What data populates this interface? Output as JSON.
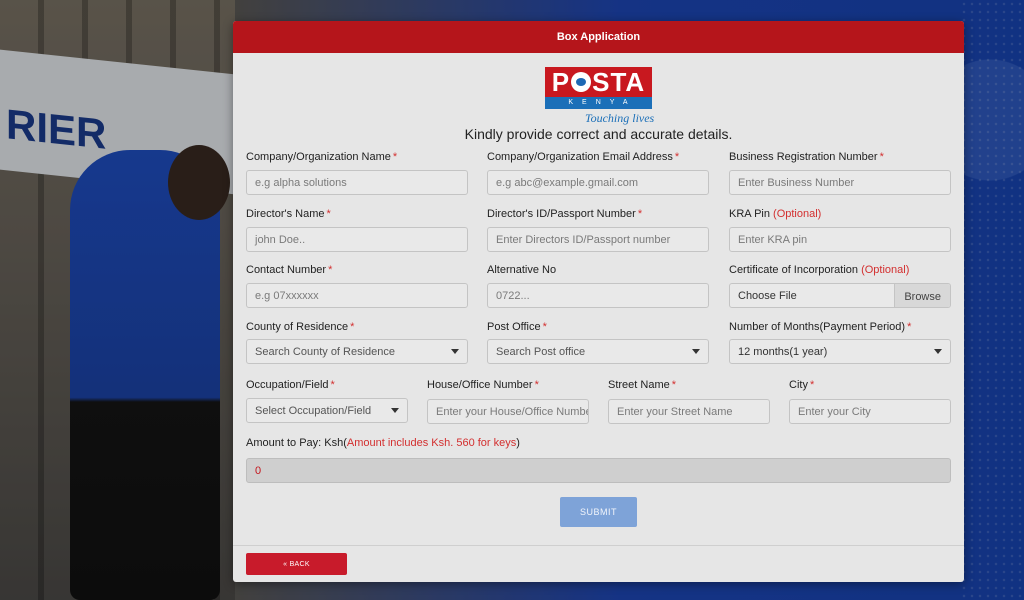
{
  "modal": {
    "title": "Box Application",
    "logo": {
      "word": "POSTA",
      "sub": "KENYA",
      "tagline": "Touching lives"
    },
    "intro": "Kindly provide correct and accurate details."
  },
  "fields": {
    "company_name": {
      "label": "Company/Organization Name",
      "required": "*",
      "placeholder": "e.g alpha solutions"
    },
    "company_email": {
      "label": "Company/Organization Email Address",
      "required": "*",
      "placeholder": "e.g abc@example.gmail.com"
    },
    "business_reg": {
      "label": "Business Registration Number",
      "required": "*",
      "placeholder": "Enter Business Number"
    },
    "director_name": {
      "label": "Director's Name",
      "required": "*",
      "placeholder": "john Doe.."
    },
    "director_id": {
      "label": "Director's ID/Passport Number",
      "required": "*",
      "placeholder": "Enter Directors ID/Passport number"
    },
    "kra_pin": {
      "label": "KRA Pin",
      "optional": "(Optional)",
      "placeholder": "Enter KRA pin"
    },
    "contact_number": {
      "label": "Contact Number",
      "required": "*",
      "placeholder": "e.g 07xxxxxx"
    },
    "alt_number": {
      "label": "Alternative No",
      "placeholder": "0722..."
    },
    "certificate": {
      "label": "Certificate of Incorporation",
      "optional": "(Optional)",
      "placeholder": "Choose File",
      "button": "Browse"
    },
    "county": {
      "label": "County of Residence",
      "required": "*",
      "value": "Search County of Residence"
    },
    "post_office": {
      "label": "Post Office",
      "required": "*",
      "value": "Search Post office"
    },
    "months": {
      "label": "Number of Months(Payment Period)",
      "required": "*",
      "value": "12 months(1 year)"
    },
    "occupation": {
      "label": "Occupation/Field",
      "required": "*",
      "value": "Select Occupation/Field"
    },
    "house_number": {
      "label": "House/Office Number",
      "required": "*",
      "placeholder": "Enter your House/Office Number"
    },
    "street": {
      "label": "Street Name",
      "required": "*",
      "placeholder": "Enter your Street Name"
    },
    "city": {
      "label": "City",
      "required": "*",
      "placeholder": "Enter your City"
    }
  },
  "amount": {
    "label": "Amount to Pay: Ksh(",
    "note": "Amount includes Ksh. 560 for keys",
    "label_end": ")",
    "value": "0"
  },
  "buttons": {
    "submit": "SUBMIT",
    "back": "« BACK"
  },
  "background": {
    "sign_text": "RIER"
  },
  "colors": {
    "header": "#b5151b",
    "submit": "#7ea3d8",
    "back": "#c81b2b",
    "required": "#d32f2f"
  }
}
